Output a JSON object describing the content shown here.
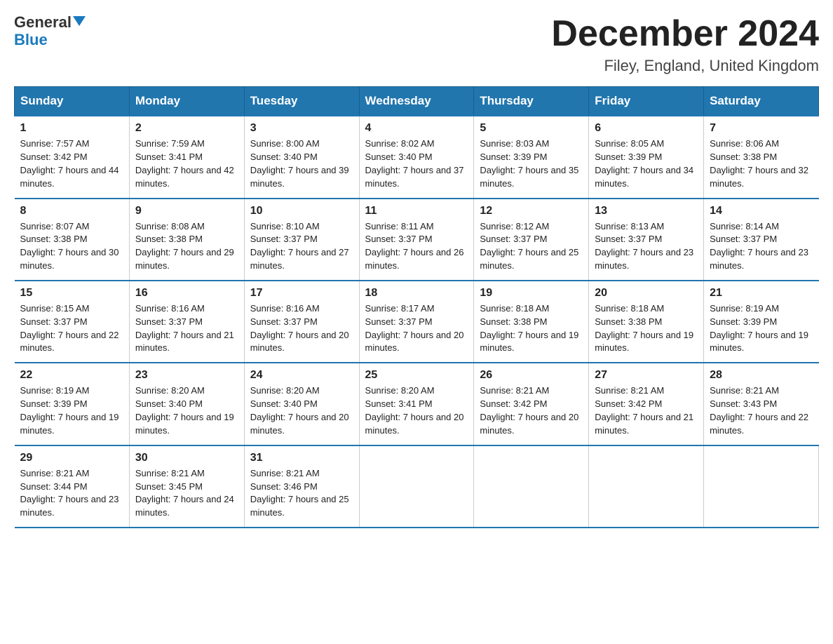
{
  "header": {
    "logo_line1": "General",
    "logo_line2": "Blue",
    "month_year": "December 2024",
    "location": "Filey, England, United Kingdom"
  },
  "days_of_week": [
    "Sunday",
    "Monday",
    "Tuesday",
    "Wednesday",
    "Thursday",
    "Friday",
    "Saturday"
  ],
  "weeks": [
    [
      {
        "day": "1",
        "sunrise": "7:57 AM",
        "sunset": "3:42 PM",
        "daylight": "7 hours and 44 minutes."
      },
      {
        "day": "2",
        "sunrise": "7:59 AM",
        "sunset": "3:41 PM",
        "daylight": "7 hours and 42 minutes."
      },
      {
        "day": "3",
        "sunrise": "8:00 AM",
        "sunset": "3:40 PM",
        "daylight": "7 hours and 39 minutes."
      },
      {
        "day": "4",
        "sunrise": "8:02 AM",
        "sunset": "3:40 PM",
        "daylight": "7 hours and 37 minutes."
      },
      {
        "day": "5",
        "sunrise": "8:03 AM",
        "sunset": "3:39 PM",
        "daylight": "7 hours and 35 minutes."
      },
      {
        "day": "6",
        "sunrise": "8:05 AM",
        "sunset": "3:39 PM",
        "daylight": "7 hours and 34 minutes."
      },
      {
        "day": "7",
        "sunrise": "8:06 AM",
        "sunset": "3:38 PM",
        "daylight": "7 hours and 32 minutes."
      }
    ],
    [
      {
        "day": "8",
        "sunrise": "8:07 AM",
        "sunset": "3:38 PM",
        "daylight": "7 hours and 30 minutes."
      },
      {
        "day": "9",
        "sunrise": "8:08 AM",
        "sunset": "3:38 PM",
        "daylight": "7 hours and 29 minutes."
      },
      {
        "day": "10",
        "sunrise": "8:10 AM",
        "sunset": "3:37 PM",
        "daylight": "7 hours and 27 minutes."
      },
      {
        "day": "11",
        "sunrise": "8:11 AM",
        "sunset": "3:37 PM",
        "daylight": "7 hours and 26 minutes."
      },
      {
        "day": "12",
        "sunrise": "8:12 AM",
        "sunset": "3:37 PM",
        "daylight": "7 hours and 25 minutes."
      },
      {
        "day": "13",
        "sunrise": "8:13 AM",
        "sunset": "3:37 PM",
        "daylight": "7 hours and 23 minutes."
      },
      {
        "day": "14",
        "sunrise": "8:14 AM",
        "sunset": "3:37 PM",
        "daylight": "7 hours and 23 minutes."
      }
    ],
    [
      {
        "day": "15",
        "sunrise": "8:15 AM",
        "sunset": "3:37 PM",
        "daylight": "7 hours and 22 minutes."
      },
      {
        "day": "16",
        "sunrise": "8:16 AM",
        "sunset": "3:37 PM",
        "daylight": "7 hours and 21 minutes."
      },
      {
        "day": "17",
        "sunrise": "8:16 AM",
        "sunset": "3:37 PM",
        "daylight": "7 hours and 20 minutes."
      },
      {
        "day": "18",
        "sunrise": "8:17 AM",
        "sunset": "3:37 PM",
        "daylight": "7 hours and 20 minutes."
      },
      {
        "day": "19",
        "sunrise": "8:18 AM",
        "sunset": "3:38 PM",
        "daylight": "7 hours and 19 minutes."
      },
      {
        "day": "20",
        "sunrise": "8:18 AM",
        "sunset": "3:38 PM",
        "daylight": "7 hours and 19 minutes."
      },
      {
        "day": "21",
        "sunrise": "8:19 AM",
        "sunset": "3:39 PM",
        "daylight": "7 hours and 19 minutes."
      }
    ],
    [
      {
        "day": "22",
        "sunrise": "8:19 AM",
        "sunset": "3:39 PM",
        "daylight": "7 hours and 19 minutes."
      },
      {
        "day": "23",
        "sunrise": "8:20 AM",
        "sunset": "3:40 PM",
        "daylight": "7 hours and 19 minutes."
      },
      {
        "day": "24",
        "sunrise": "8:20 AM",
        "sunset": "3:40 PM",
        "daylight": "7 hours and 20 minutes."
      },
      {
        "day": "25",
        "sunrise": "8:20 AM",
        "sunset": "3:41 PM",
        "daylight": "7 hours and 20 minutes."
      },
      {
        "day": "26",
        "sunrise": "8:21 AM",
        "sunset": "3:42 PM",
        "daylight": "7 hours and 20 minutes."
      },
      {
        "day": "27",
        "sunrise": "8:21 AM",
        "sunset": "3:42 PM",
        "daylight": "7 hours and 21 minutes."
      },
      {
        "day": "28",
        "sunrise": "8:21 AM",
        "sunset": "3:43 PM",
        "daylight": "7 hours and 22 minutes."
      }
    ],
    [
      {
        "day": "29",
        "sunrise": "8:21 AM",
        "sunset": "3:44 PM",
        "daylight": "7 hours and 23 minutes."
      },
      {
        "day": "30",
        "sunrise": "8:21 AM",
        "sunset": "3:45 PM",
        "daylight": "7 hours and 24 minutes."
      },
      {
        "day": "31",
        "sunrise": "8:21 AM",
        "sunset": "3:46 PM",
        "daylight": "7 hours and 25 minutes."
      },
      null,
      null,
      null,
      null
    ]
  ]
}
